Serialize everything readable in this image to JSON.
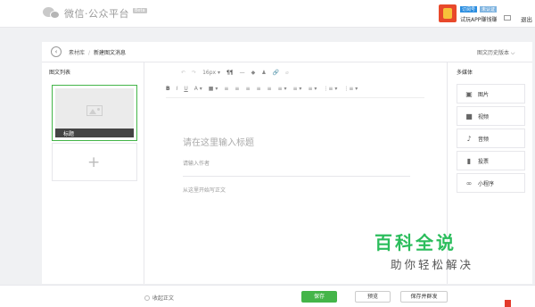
{
  "topbar": {
    "logo_text": "微信·公众平台",
    "beta": "Beta",
    "account": {
      "tag1": "订阅号",
      "tag2": "未认证",
      "name": "试玩APP赚钱赚",
      "logout": "退出"
    }
  },
  "header": {
    "back": "‹",
    "breadcrumb_root": "素材库",
    "separator": "/",
    "breadcrumb_current": "新建图文消息",
    "history": "图文历史版本 ⌵"
  },
  "left": {
    "title": "图文列表",
    "cover_title": "标题",
    "add": "+"
  },
  "toolbar": {
    "row1": [
      "↶",
      "↷",
      "16px ▾",
      "¶¶",
      "—",
      "◆",
      "♟",
      "🔗",
      "⌀"
    ],
    "row2": [
      "B",
      "I",
      "U",
      "A ▾",
      "■ ▾",
      "≡",
      "≡",
      "≡",
      "≡",
      "≡",
      "≡ ▾",
      "≡ ▾",
      "≡ ▾",
      "⋮≡ ▾",
      "⋮≡ ▾"
    ]
  },
  "editor": {
    "title_placeholder": "请在这里输入标题",
    "author_placeholder": "请输入作者",
    "body_placeholder": "从这里开始写正文"
  },
  "right": {
    "title": "多媒体",
    "items": [
      {
        "icon": "image-icon",
        "glyph": "▣",
        "label": "图片"
      },
      {
        "icon": "video-icon",
        "glyph": "■",
        "label": "视频"
      },
      {
        "icon": "microphone-icon",
        "glyph": "♪",
        "label": "音频"
      },
      {
        "icon": "vote-icon",
        "glyph": "▮",
        "label": "投票"
      },
      {
        "icon": "mini-program-icon",
        "glyph": "∞",
        "label": "小程序"
      }
    ]
  },
  "watermark": {
    "big": "百科全说",
    "small": "助你轻松解决"
  },
  "bottom": {
    "collapse": "收起正文",
    "save": "保存",
    "preview": "预览",
    "save_send": "保存并群发"
  },
  "colors": {
    "accent": "#44b549",
    "watermark": "#2bbd5c"
  }
}
